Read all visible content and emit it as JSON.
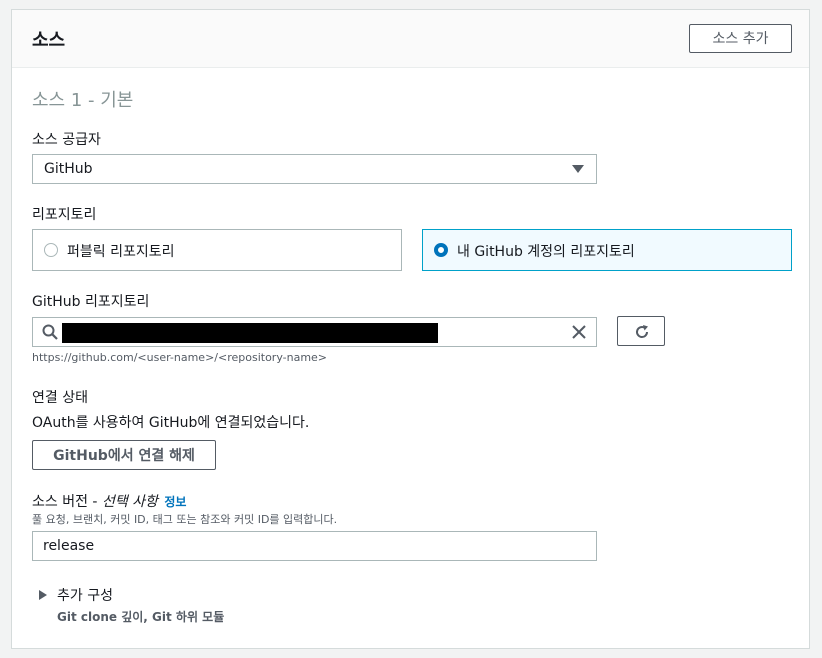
{
  "panel": {
    "title": "소스",
    "add_source_label": "소스 추가"
  },
  "section": {
    "title": "소스 1 - 기본"
  },
  "source_provider": {
    "label": "소스 공급자",
    "value": "GitHub"
  },
  "repository": {
    "label": "리포지토리",
    "options": [
      {
        "label": "퍼블릭 리포지토리",
        "selected": false
      },
      {
        "label": "내 GitHub 계정의 리포지토리",
        "selected": true
      }
    ]
  },
  "github_repo": {
    "label": "GitHub 리포지토리",
    "hint": "https://github.com/<user-name>/<repository-name>"
  },
  "connection": {
    "label": "연결 상태",
    "status_text": "OAuth를 사용하여 GitHub에 연결되었습니다.",
    "disconnect_label": "GitHub에서 연결 해제"
  },
  "source_version": {
    "label": "소스 버전 - ",
    "optional": "선택 사항",
    "info": "정보",
    "hint": "풀 요청, 브랜치, 커밋 ID, 태그 또는 참조와 커밋 ID를 입력합니다.",
    "value": "release"
  },
  "additional_config": {
    "label": "추가 구성",
    "description": "Git clone 깊이, Git 하위 모듈"
  },
  "colors": {
    "accent": "#0073bb",
    "selected_border": "#00a1c9"
  }
}
